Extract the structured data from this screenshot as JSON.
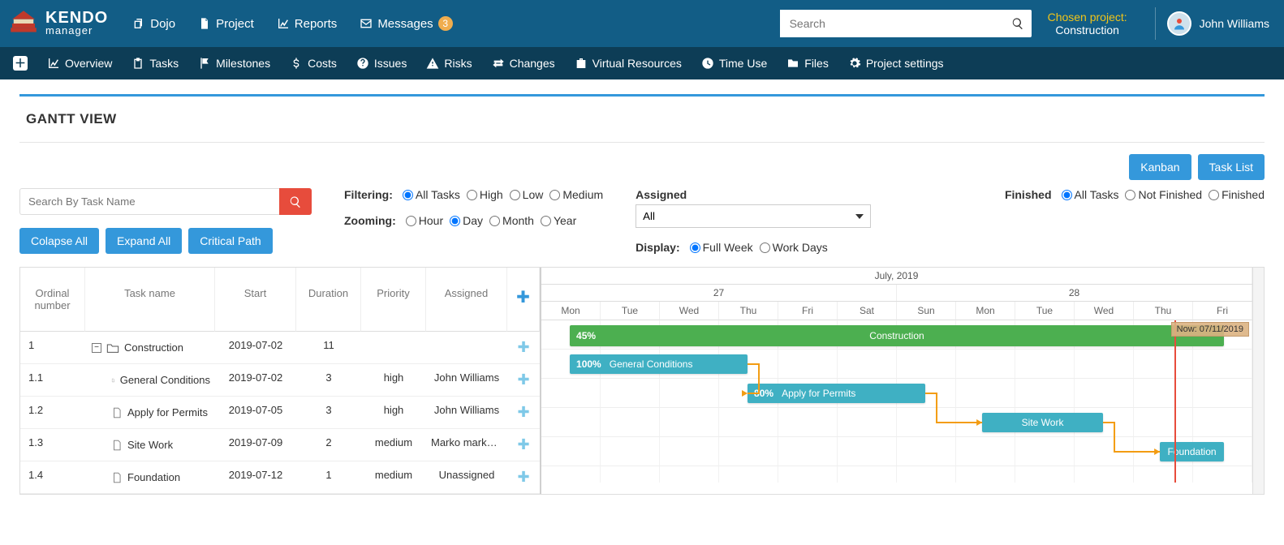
{
  "brand": {
    "line1": "KENDO",
    "line2": "manager"
  },
  "topnav": {
    "dojo": "Dojo",
    "project": "Project",
    "reports": "Reports",
    "messages": "Messages",
    "messages_badge": "3"
  },
  "search": {
    "placeholder": "Search"
  },
  "chosen_project": {
    "label": "Chosen project:",
    "value": "Construction"
  },
  "user": {
    "name": "John Williams"
  },
  "subnav": {
    "overview": "Overview",
    "tasks": "Tasks",
    "milestones": "Milestones",
    "costs": "Costs",
    "issues": "Issues",
    "risks": "Risks",
    "changes": "Changes",
    "virtual_resources": "Virtual Resources",
    "time_use": "Time Use",
    "files": "Files",
    "project_settings": "Project settings"
  },
  "page": {
    "title": "GANTT VIEW"
  },
  "view_buttons": {
    "kanban": "Kanban",
    "task_list": "Task List"
  },
  "task_search": {
    "placeholder": "Search By Task Name"
  },
  "ctrl_buttons": {
    "collapse": "Colapse All",
    "expand": "Expand All",
    "critical": "Critical Path"
  },
  "filtering": {
    "label": "Filtering:",
    "all": "All Tasks",
    "high": "High",
    "low": "Low",
    "medium": "Medium",
    "selected": "all"
  },
  "zooming": {
    "label": "Zooming:",
    "hour": "Hour",
    "day": "Day",
    "month": "Month",
    "year": "Year",
    "selected": "day"
  },
  "assigned": {
    "label": "Assigned",
    "value": "All"
  },
  "display": {
    "label": "Display:",
    "full": "Full Week",
    "work": "Work Days",
    "selected": "full"
  },
  "finished": {
    "label": "Finished",
    "all": "All Tasks",
    "not": "Not Finished",
    "fin": "Finished",
    "selected": "all"
  },
  "grid": {
    "cols": {
      "ord": "Ordinal number",
      "name": "Task name",
      "start": "Start",
      "dur": "Duration",
      "pri": "Priority",
      "asg": "Assigned"
    },
    "rows": [
      {
        "ord": "1",
        "name": "Construction",
        "start": "2019-07-02",
        "dur": "11",
        "pri": "",
        "asg": "",
        "type": "parent"
      },
      {
        "ord": "1.1",
        "name": "General Conditions",
        "start": "2019-07-02",
        "dur": "3",
        "pri": "high",
        "asg": "John Williams",
        "type": "task"
      },
      {
        "ord": "1.2",
        "name": "Apply for Permits",
        "start": "2019-07-05",
        "dur": "3",
        "pri": "high",
        "asg": "John Williams",
        "type": "task"
      },
      {
        "ord": "1.3",
        "name": "Site Work",
        "start": "2019-07-09",
        "dur": "2",
        "pri": "medium",
        "asg": "Marko marković",
        "type": "task"
      },
      {
        "ord": "1.4",
        "name": "Foundation",
        "start": "2019-07-12",
        "dur": "1",
        "pri": "medium",
        "asg": "Unassigned",
        "type": "task"
      }
    ]
  },
  "timeline": {
    "month": "July, 2019",
    "weeks": [
      "27",
      "28"
    ],
    "days": [
      "Mon",
      "Tue",
      "Wed",
      "Thu",
      "Fri",
      "Sat",
      "Sun",
      "Mon",
      "Tue",
      "Wed",
      "Thu",
      "Fri"
    ],
    "now_label": "Now: 07/11/2019",
    "now_pct": 89,
    "bars": [
      {
        "row": 0,
        "start_pct": 4,
        "width_pct": 92,
        "label": "Construction",
        "pct": "45%",
        "parent": true
      },
      {
        "row": 1,
        "start_pct": 4,
        "width_pct": 25,
        "label": "General Conditions",
        "pct": "100%",
        "parent": false
      },
      {
        "row": 2,
        "start_pct": 29,
        "width_pct": 25,
        "label": "Apply for Permits",
        "pct": "80%",
        "parent": false
      },
      {
        "row": 3,
        "start_pct": 62,
        "width_pct": 17,
        "label": "Site Work",
        "pct": "",
        "parent": false,
        "center": true
      },
      {
        "row": 4,
        "start_pct": 87,
        "width_pct": 9,
        "label": "Foundation",
        "pct": "",
        "parent": false,
        "center": true
      }
    ]
  }
}
